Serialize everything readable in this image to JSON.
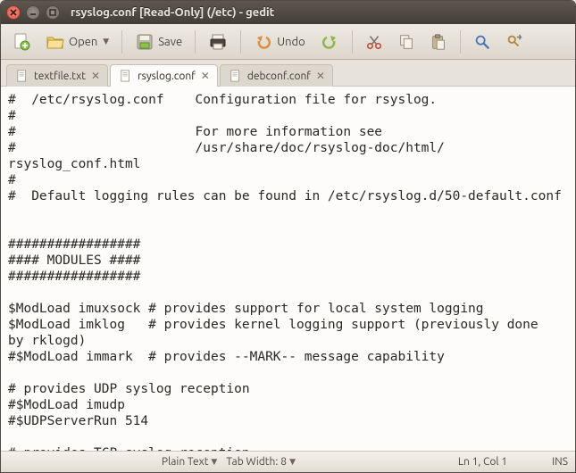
{
  "window": {
    "title": "rsyslog.conf [Read-Only] (/etc) - gedit"
  },
  "toolbar": {
    "open_label": "Open",
    "save_label": "Save",
    "undo_label": "Undo"
  },
  "tabs": [
    {
      "label": "textfile.txt",
      "active": false
    },
    {
      "label": "rsyslog.conf",
      "active": true
    },
    {
      "label": "debconf.conf",
      "active": false
    }
  ],
  "editor": {
    "content": "#  /etc/rsyslog.conf    Configuration file for rsyslog.\n#\n#                       For more information see\n#                       /usr/share/doc/rsyslog-doc/html/\nrsyslog_conf.html\n#\n#  Default logging rules can be found in /etc/rsyslog.d/50-default.conf\n\n\n#################\n#### MODULES ####\n#################\n\n$ModLoad imuxsock # provides support for local system logging\n$ModLoad imklog   # provides kernel logging support (previously done\nby rklogd)\n#$ModLoad immark  # provides --MARK-- message capability\n\n# provides UDP syslog reception\n#$ModLoad imudp\n#$UDPServerRun 514\n\n# provides TCP syslog reception"
  },
  "statusbar": {
    "highlight_mode": "Plain Text",
    "tab_width_label": "Tab Width:",
    "tab_width_value": "8",
    "cursor": "Ln 1, Col 1",
    "insert_mode": "INS"
  }
}
